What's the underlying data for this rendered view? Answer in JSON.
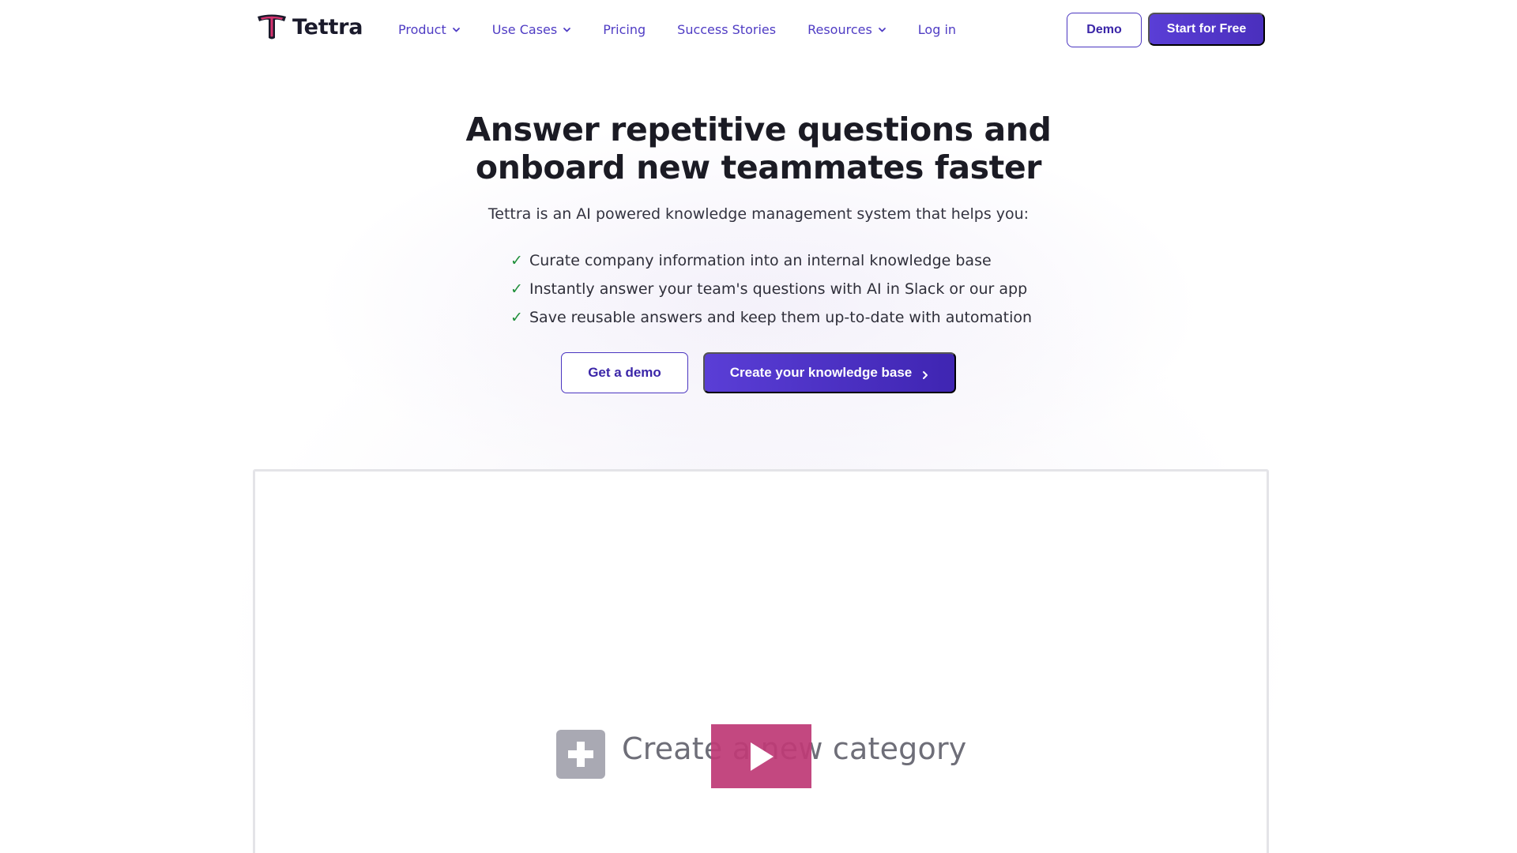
{
  "brand": {
    "name": "Tettra",
    "color_pink": "#d7336f",
    "color_dark": "#1a1a2b"
  },
  "nav": {
    "items": [
      {
        "label": "Product",
        "dropdown": true
      },
      {
        "label": "Use Cases",
        "dropdown": true
      },
      {
        "label": "Pricing",
        "dropdown": false
      },
      {
        "label": "Success Stories",
        "dropdown": false
      },
      {
        "label": "Resources",
        "dropdown": true
      },
      {
        "label": "Log in",
        "dropdown": false
      }
    ],
    "demo_label": "Demo",
    "start_label": "Start for Free"
  },
  "hero": {
    "title_line1": "Answer repetitive questions and",
    "title_line2": "onboard new teammates faster",
    "subtitle": "Tettra is an AI powered knowledge management system that helps you:",
    "check_icon": "check-icon",
    "bullets": [
      "Curate company information into an internal knowledge base",
      "Instantly answer your team's questions with AI in Slack or our app",
      "Save reusable answers and keep them up-to-date with automation"
    ],
    "get_demo_label": "Get a demo",
    "create_label": "Create your knowledge base"
  },
  "video": {
    "caption": "Create a new category",
    "caption_icon": "plus-icon",
    "play_icon": "play-icon",
    "play_color": "#be3a76"
  },
  "colors": {
    "accent": "#4f3cc4",
    "button_primary": "#4a2fbd",
    "check_green": "#1f8f3a"
  }
}
